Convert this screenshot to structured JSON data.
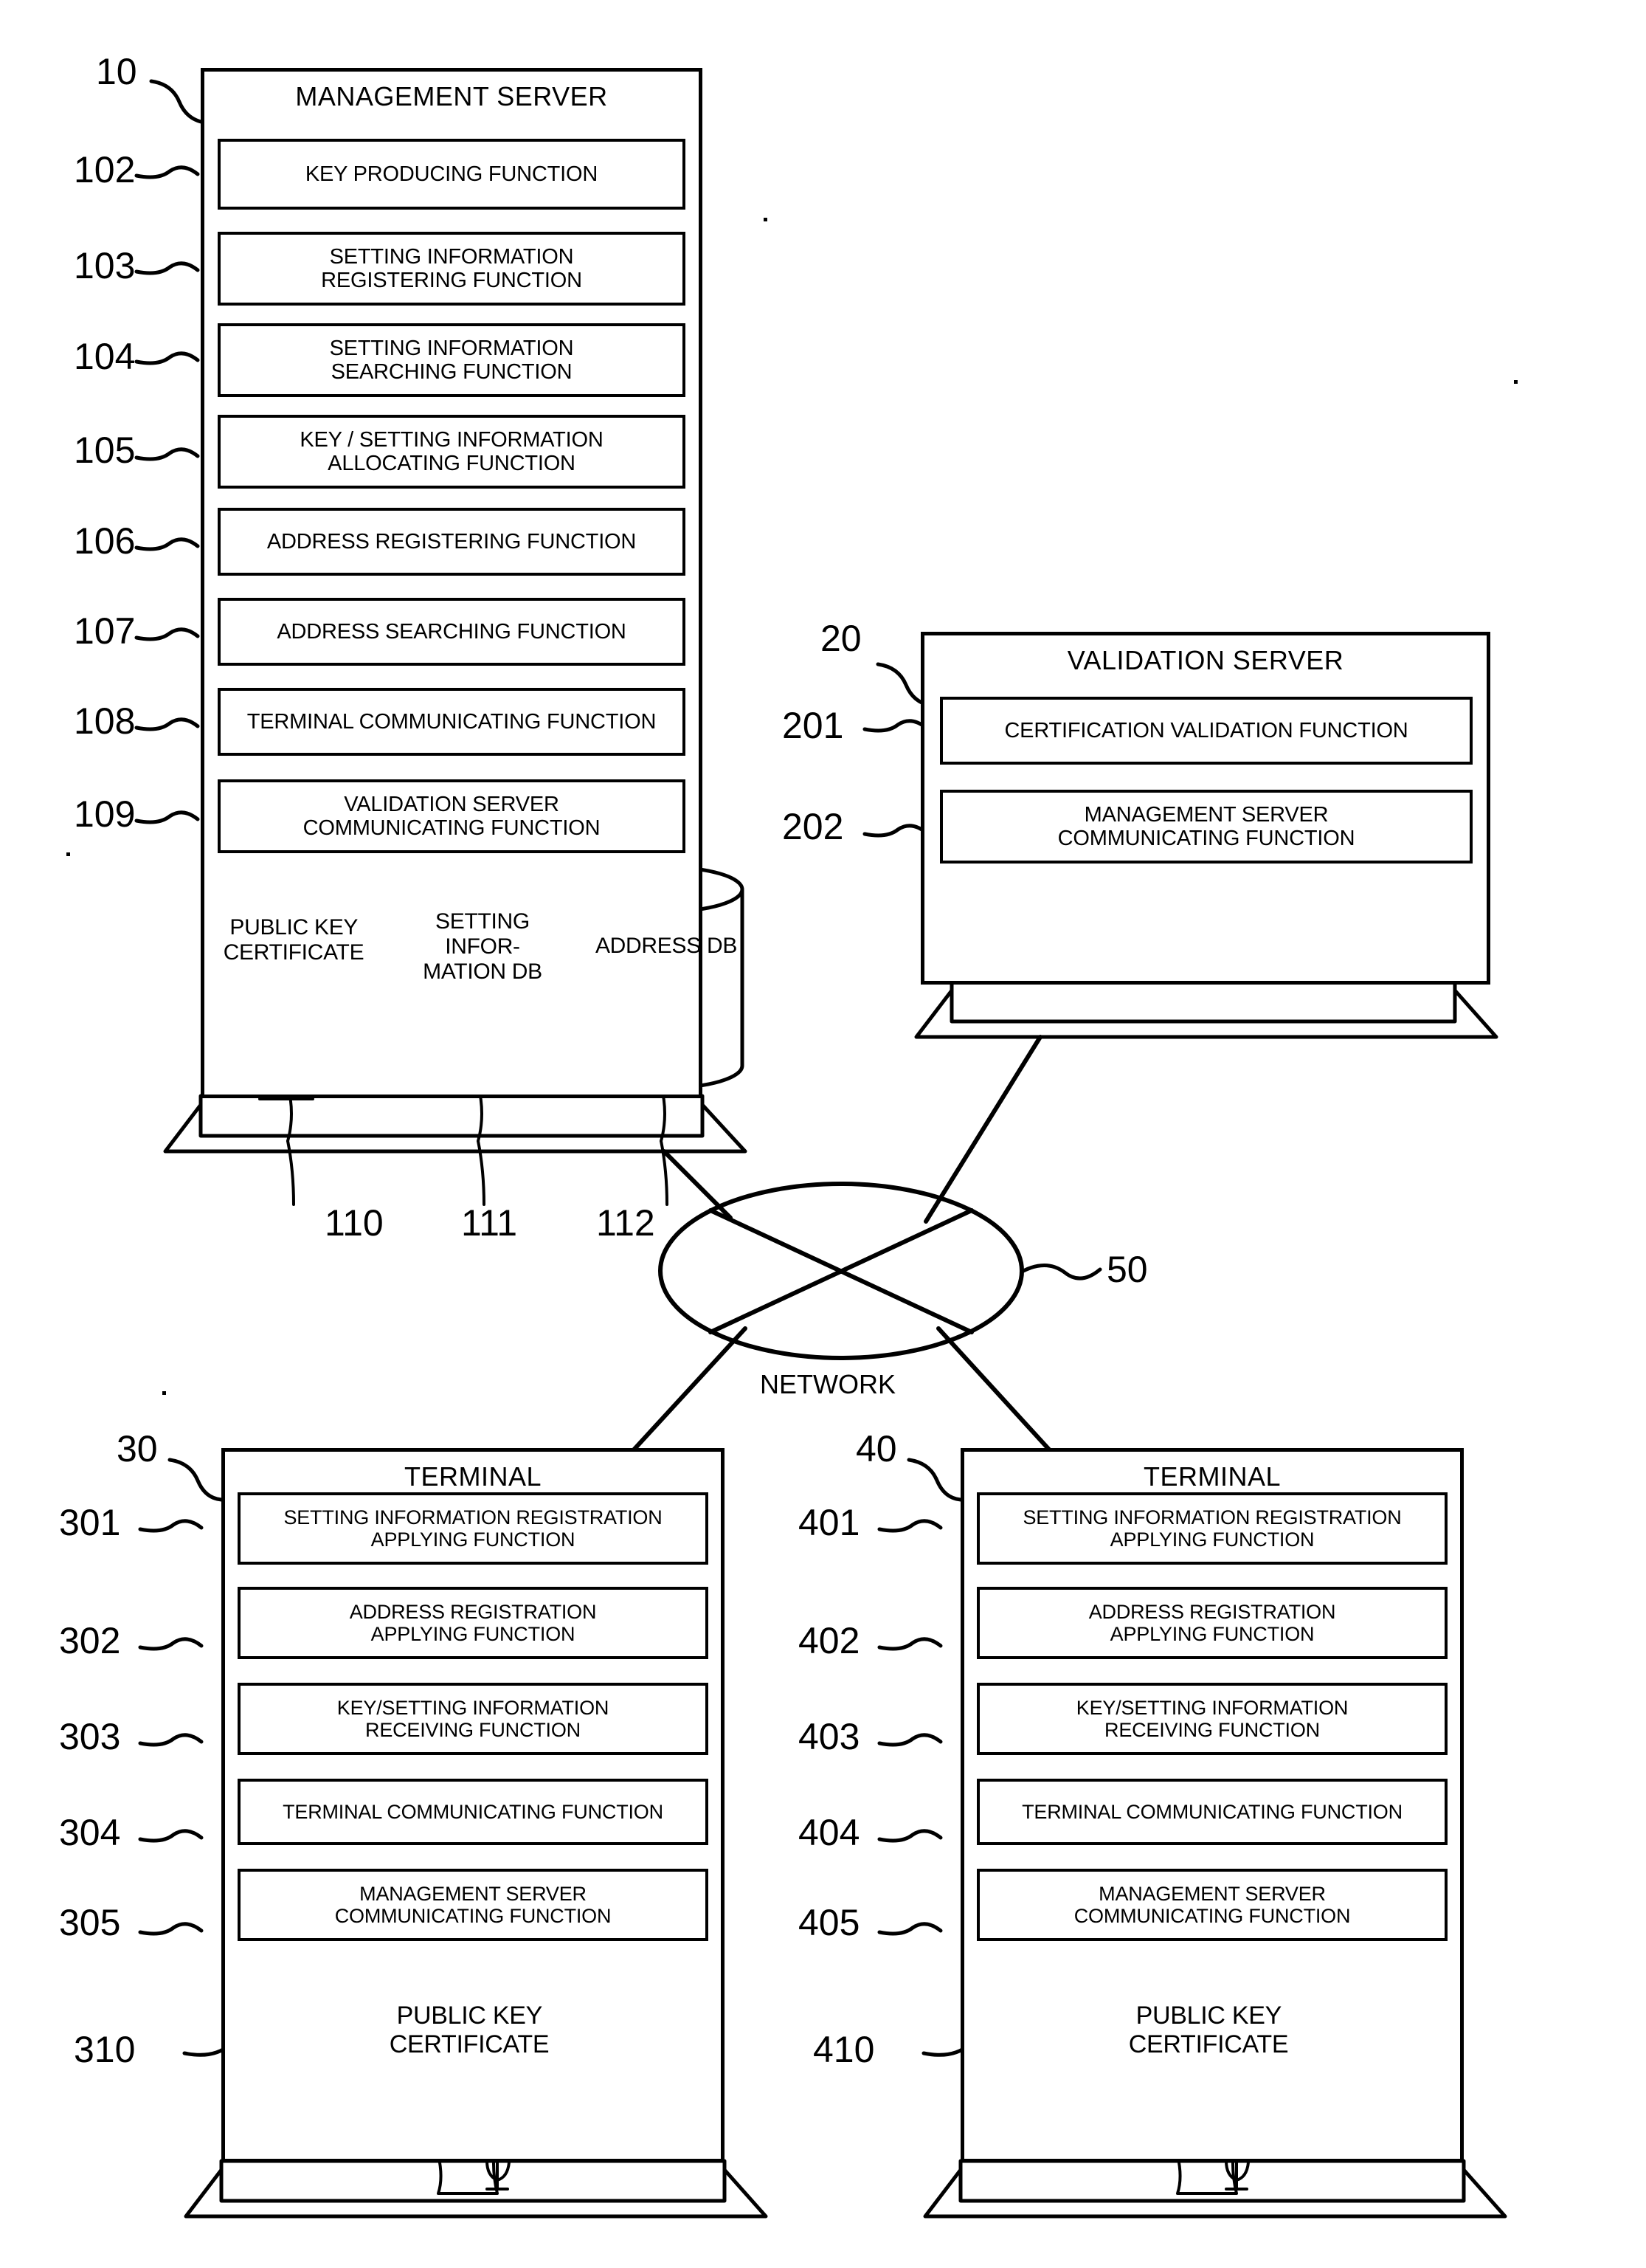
{
  "figure": {
    "type": "patent-system-architecture-diagram",
    "network": {
      "label": "NETWORK",
      "ref": "50"
    }
  },
  "management_server": {
    "ref": "10",
    "title": "MANAGEMENT SERVER",
    "functions": [
      {
        "ref": "102",
        "lines": [
          "KEY PRODUCING FUNCTION"
        ]
      },
      {
        "ref": "103",
        "lines": [
          "SETTING INFORMATION",
          "REGISTERING FUNCTION"
        ]
      },
      {
        "ref": "104",
        "lines": [
          "SETTING INFORMATION",
          "SEARCHING FUNCTION"
        ]
      },
      {
        "ref": "105",
        "lines": [
          "KEY / SETTING INFORMATION",
          "ALLOCATING FUNCTION"
        ]
      },
      {
        "ref": "106",
        "lines": [
          "ADDRESS REGISTERING FUNCTION"
        ]
      },
      {
        "ref": "107",
        "lines": [
          "ADDRESS SEARCHING FUNCTION"
        ]
      },
      {
        "ref": "108",
        "lines": [
          "TERMINAL COMMUNICATING FUNCTION"
        ]
      },
      {
        "ref": "109",
        "lines": [
          "VALIDATION SERVER",
          "COMMUNICATING FUNCTION"
        ]
      }
    ],
    "databases": [
      {
        "ref": "110",
        "lines": [
          "PUBLIC KEY",
          "CERTIFICATE"
        ],
        "icon": "scroll-certificate-icon"
      },
      {
        "ref": "111",
        "lines": [
          "SETTING",
          "INFOR-",
          "MATION DB"
        ],
        "icon": null
      },
      {
        "ref": "112",
        "lines": [
          "ADDRESS",
          "DB"
        ],
        "icon": null
      }
    ]
  },
  "validation_server": {
    "ref": "20",
    "title": "VALIDATION SERVER",
    "functions": [
      {
        "ref": "201",
        "lines": [
          "CERTIFICATION VALIDATION FUNCTION"
        ]
      },
      {
        "ref": "202",
        "lines": [
          "MANAGEMENT SERVER",
          "COMMUNICATING FUNCTION"
        ]
      }
    ]
  },
  "terminal_left": {
    "ref": "30",
    "title": "TERMINAL",
    "functions": [
      {
        "ref": "301",
        "lines": [
          "SETTING INFORMATION REGISTRATION",
          "APPLYING FUNCTION"
        ]
      },
      {
        "ref": "302",
        "lines": [
          "ADDRESS REGISTRATION",
          "APPLYING FUNCTION"
        ]
      },
      {
        "ref": "303",
        "lines": [
          "KEY/SETTING INFORMATION",
          "RECEIVING FUNCTION"
        ]
      },
      {
        "ref": "304",
        "lines": [
          "TERMINAL COMMUNICATING FUNCTION"
        ]
      },
      {
        "ref": "305",
        "lines": [
          "MANAGEMENT SERVER",
          "COMMUNICATING FUNCTION"
        ]
      }
    ],
    "database": {
      "ref": "310",
      "lines": [
        "PUBLIC KEY",
        "CERTIFICATE"
      ],
      "icon": "scroll-certificate-icon"
    }
  },
  "terminal_right": {
    "ref": "40",
    "title": "TERMINAL",
    "functions": [
      {
        "ref": "401",
        "lines": [
          "SETTING INFORMATION REGISTRATION",
          "APPLYING FUNCTION"
        ]
      },
      {
        "ref": "402",
        "lines": [
          "ADDRESS REGISTRATION",
          "APPLYING FUNCTION"
        ]
      },
      {
        "ref": "403",
        "lines": [
          "KEY/SETTING INFORMATION",
          "RECEIVING FUNCTION"
        ]
      },
      {
        "ref": "404",
        "lines": [
          "TERMINAL COMMUNICATING FUNCTION"
        ]
      },
      {
        "ref": "405",
        "lines": [
          "MANAGEMENT SERVER",
          "COMMUNICATING FUNCTION"
        ]
      }
    ],
    "database": {
      "ref": "410",
      "lines": [
        "PUBLIC KEY",
        "CERTIFICATE"
      ],
      "icon": "scroll-certificate-icon"
    }
  },
  "colors": {
    "ink": "#000000",
    "paper": "#ffffff"
  }
}
